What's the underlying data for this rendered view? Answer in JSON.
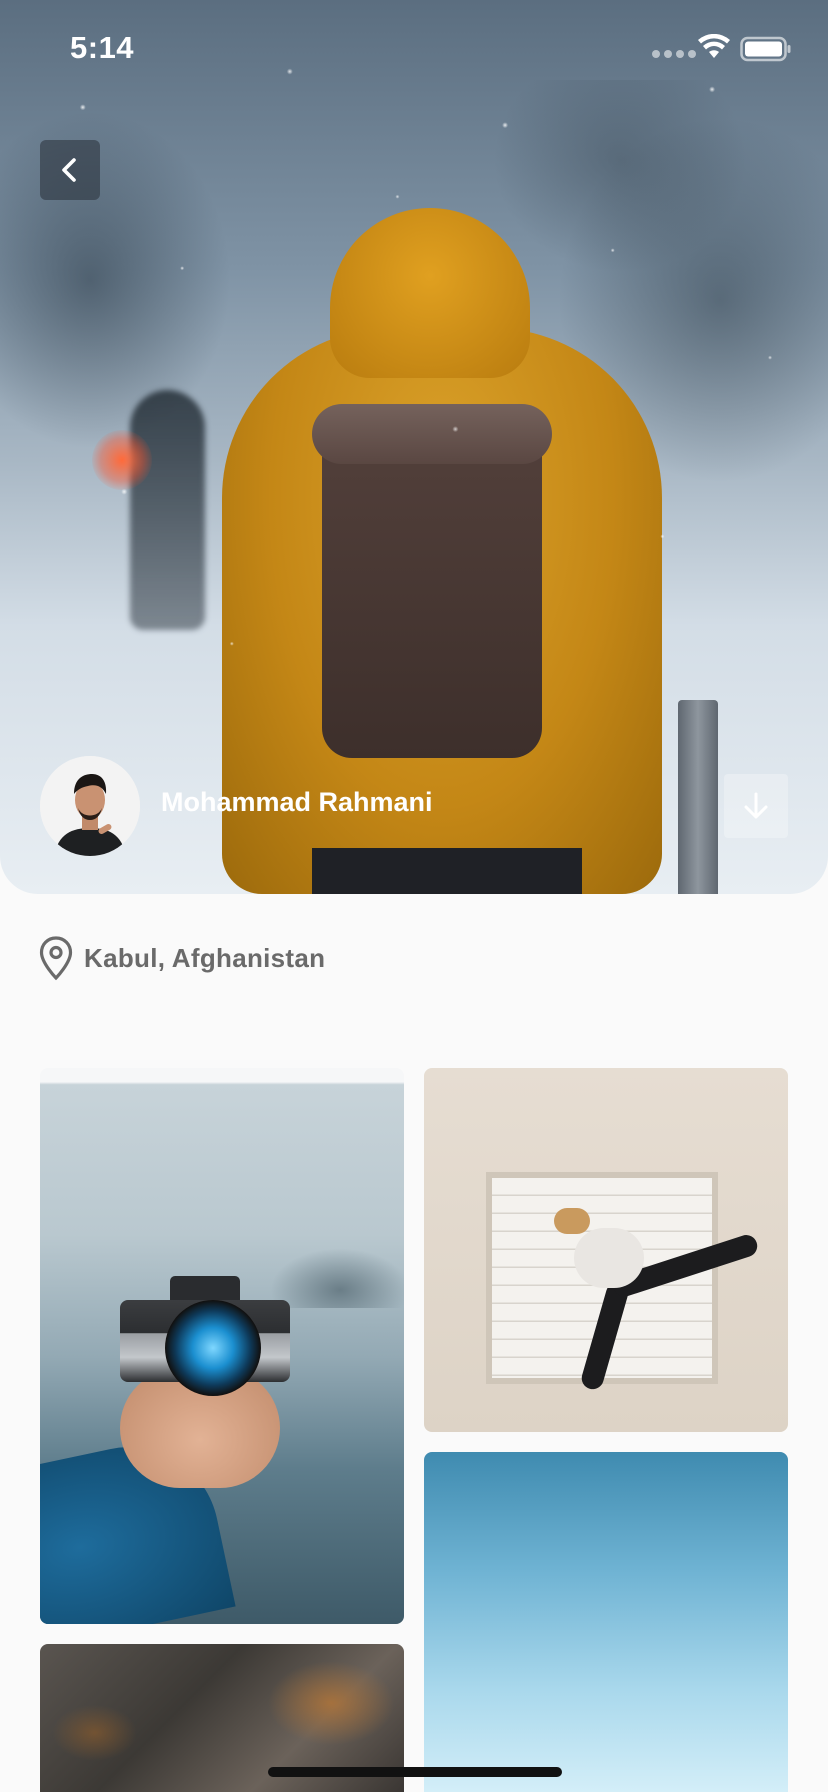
{
  "status_bar": {
    "time": "5:14",
    "wifi_icon": "wifi-icon",
    "battery_icon": "battery-icon"
  },
  "header": {
    "back_icon": "chevron-left-icon"
  },
  "photo": {
    "author_name": "Mohammad Rahmani",
    "download_icon": "arrow-down-icon",
    "location": "Kabul, Afghanistan",
    "location_icon": "map-pin-icon"
  },
  "gallery": {
    "photos": [
      "camera-photo",
      "wall-jump-photo",
      "sky-photo",
      "rock-photo"
    ]
  },
  "colors": {
    "background": "#fafafa",
    "text_secondary": "#6a6a6a",
    "overlay_text": "#ffffff"
  }
}
